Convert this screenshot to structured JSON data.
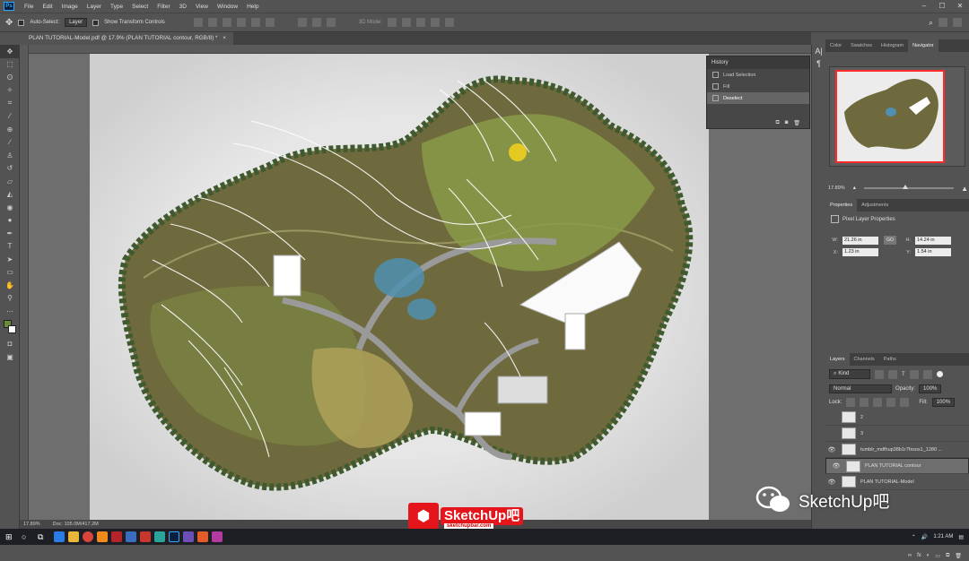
{
  "app": {
    "logo": "Ps",
    "menus": [
      "File",
      "Edit",
      "Image",
      "Layer",
      "Type",
      "Select",
      "Filter",
      "3D",
      "View",
      "Window",
      "Help"
    ]
  },
  "options": {
    "auto_select_label": "Auto-Select:",
    "auto_select_target": "Layer",
    "transform_label": "Show Transform Controls",
    "mode_3d": "3D Mode:"
  },
  "document": {
    "tab_title": "PLAN TUTORIAL-Model.pdf @ 17.9% (PLAN TUTORIAL contour, RGB/8) *",
    "zoom": "17.89%",
    "doc_size": "Doc: 105.0M/417.2M"
  },
  "history": {
    "title": "History",
    "items": [
      "Load Selection",
      "Fill",
      "Deselect"
    ],
    "active_index": 2
  },
  "right_tabs": [
    "Color",
    "Swatches",
    "Histogram",
    "Navigator"
  ],
  "navigator": {
    "zoom": "17.89%"
  },
  "properties": {
    "tabs": [
      "Properties",
      "Adjustments"
    ],
    "kind": "Pixel Layer Properties",
    "w": "21.26 in",
    "h": "14.24 in",
    "x": "1.23 in",
    "y": "1.54 in",
    "labels": {
      "w": "W:",
      "h": "H:",
      "x": "X:",
      "y": "Y:",
      "go": "GO"
    }
  },
  "layers": {
    "tabs": [
      "Layers",
      "Channels",
      "Paths"
    ],
    "filter": "Kind",
    "blend": "Normal",
    "opacity_label": "Opacity:",
    "opacity": "100%",
    "lock_label": "Lock:",
    "fill_label": "Fill:",
    "fill": "100%",
    "rows": [
      {
        "name": "2",
        "visible": false
      },
      {
        "name": "3",
        "visible": false
      },
      {
        "name": "tumblr_mdfhup38b1r7fxsos1_1280 ...",
        "visible": true
      },
      {
        "name": "PLAN TUTORIAL contour",
        "visible": true,
        "selected": true
      },
      {
        "name": "PLAN TUTORIAL-Model",
        "visible": true
      }
    ]
  },
  "taskbar": {
    "time": "1:21 AM"
  },
  "watermark": {
    "brand": "SketchUp",
    "suffix": "吧",
    "url": "sketchupbar.com",
    "wechat": "SketchUp吧"
  },
  "colors": {
    "fg": "#6b8a3a",
    "bg": "#ffffff",
    "nav_frame": "#ff2a2a"
  }
}
